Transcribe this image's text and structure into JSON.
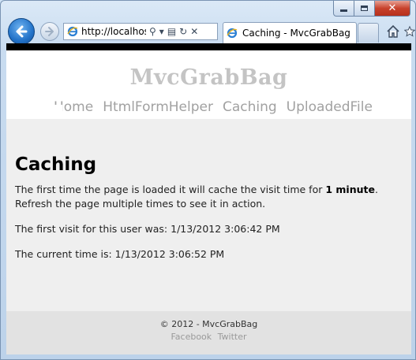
{
  "browser": {
    "address": "http://localhost",
    "tab_title": "Caching - MvcGrabBag",
    "icons": {
      "back": "back-arrow-icon",
      "forward": "forward-arrow-icon",
      "search": "search-icon",
      "dropdown": "dropdown-icon",
      "compat": "compatibility-view-icon",
      "refresh": "refresh-icon",
      "stop": "stop-icon",
      "home": "home-icon",
      "favorites": "favorites-star-icon"
    },
    "colors": {
      "accent": "#2272c8",
      "close_button": "#c8422c"
    }
  },
  "site": {
    "title": "MvcGrabBag",
    "menu": [
      {
        "label": "Home"
      },
      {
        "label": "HtmlFormHelper"
      },
      {
        "label": "Caching"
      },
      {
        "label": "UploadedFile"
      }
    ]
  },
  "main": {
    "heading": "Caching",
    "intro_before": "The first time the page is loaded it will cache the visit time for ",
    "intro_bold": "1 minute",
    "intro_after": ". Refresh the page multiple times to see it in action.",
    "first_visit": "The first visit for this user was: 1/13/2012 3:06:42 PM",
    "current_time": "The current time is: 1/13/2012 3:06:52 PM"
  },
  "footer": {
    "copyright": "© 2012 - MvcGrabBag",
    "links": [
      {
        "label": "Facebook"
      },
      {
        "label": "Twitter"
      }
    ]
  }
}
